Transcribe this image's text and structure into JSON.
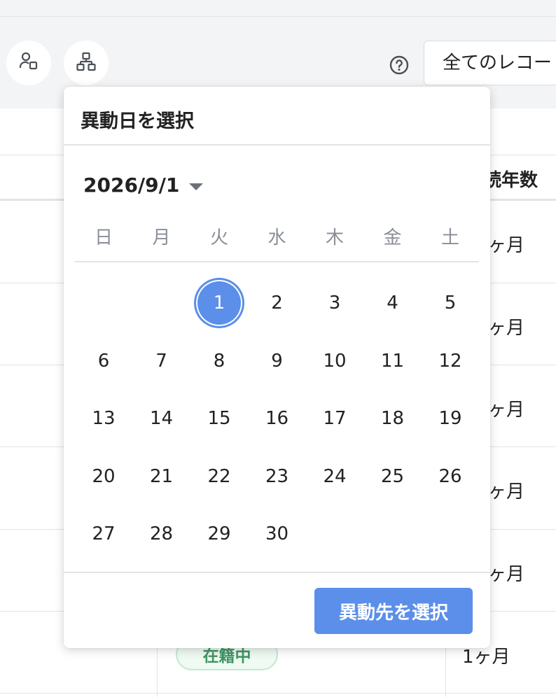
{
  "toolbar": {
    "icons": [
      "user-assign-icon",
      "org-chart-icon",
      "help-icon"
    ],
    "record_filter_value": "全てのレコー"
  },
  "table": {
    "visible_header": "続年数",
    "rows": [
      {
        "tenure": "ヶ月"
      },
      {
        "tenure": "ヶ月"
      },
      {
        "tenure": "ヶ月"
      },
      {
        "tenure": "ヶ月"
      },
      {
        "tenure": "ヶ月"
      },
      {
        "status": "在籍中",
        "tenure": "1ヶ月"
      }
    ]
  },
  "date_picker": {
    "title": "異動日を選択",
    "selected_date": "2026/9/1",
    "weekdays": [
      "日",
      "月",
      "火",
      "水",
      "木",
      "金",
      "土"
    ],
    "first_weekday_index": 2,
    "days_in_month": 30,
    "selected_day": 1,
    "next_button_label": "異動先を選択"
  },
  "colors": {
    "accent": "#5b8fe9",
    "status_green": "#3f9463",
    "toolbar_bg": "#f3f4f6"
  }
}
